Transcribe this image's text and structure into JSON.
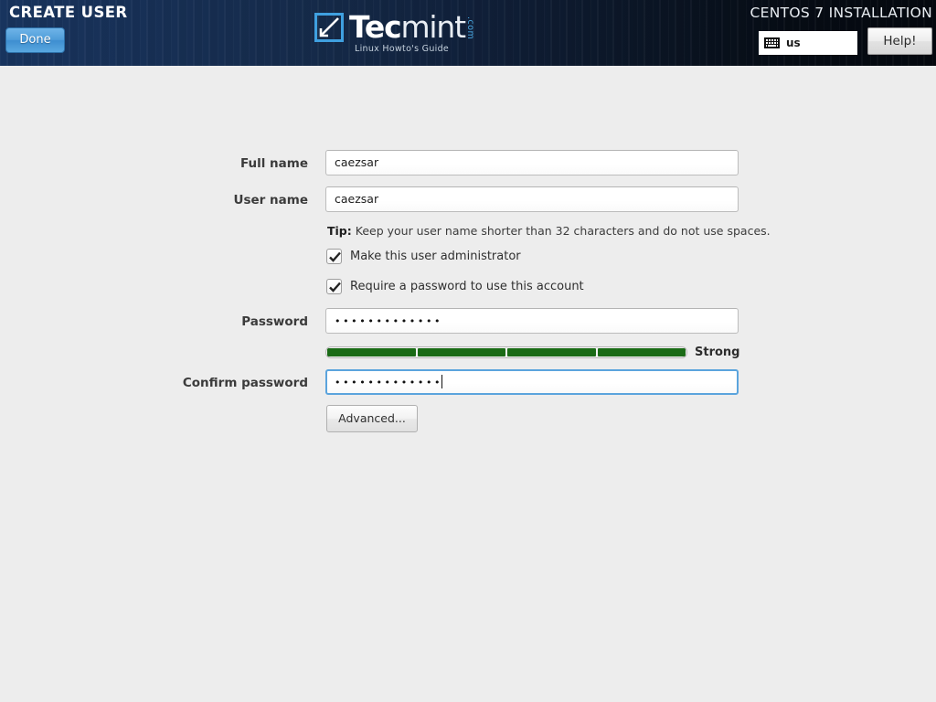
{
  "header": {
    "screen_title": "CREATE USER",
    "done_label": "Done",
    "install_title": "CENTOS 7 INSTALLATION",
    "keyboard_layout": "us",
    "keyboard_icon": "keyboard-icon",
    "help_label": "Help!",
    "logo": {
      "word_primary": "Tec",
      "word_secondary": "mint",
      "dotcom": ".com",
      "tagline": "Linux Howto's Guide"
    },
    "colors": {
      "header_left": "#18345e",
      "header_right": "#04080e",
      "done_button": "#4e9cd9"
    }
  },
  "form": {
    "full_name": {
      "label": "Full name",
      "value": "caezsar"
    },
    "user_name": {
      "label": "User name",
      "value": "caezsar"
    },
    "tip_prefix": "Tip:",
    "tip_text": " Keep your user name shorter than 32 characters and do not use spaces.",
    "checkboxes": [
      {
        "label": "Make this user administrator",
        "checked": true
      },
      {
        "label": "Require a password to use this account",
        "checked": true
      }
    ],
    "password": {
      "label": "Password",
      "value": "•••••••••••••"
    },
    "confirm_password": {
      "label": "Confirm password",
      "value": "•••••••••••••",
      "focused": true
    },
    "strength": {
      "text": "Strong",
      "segments": 4,
      "filled": 4,
      "color": "#1a6b16"
    },
    "advanced_label": "Advanced..."
  }
}
